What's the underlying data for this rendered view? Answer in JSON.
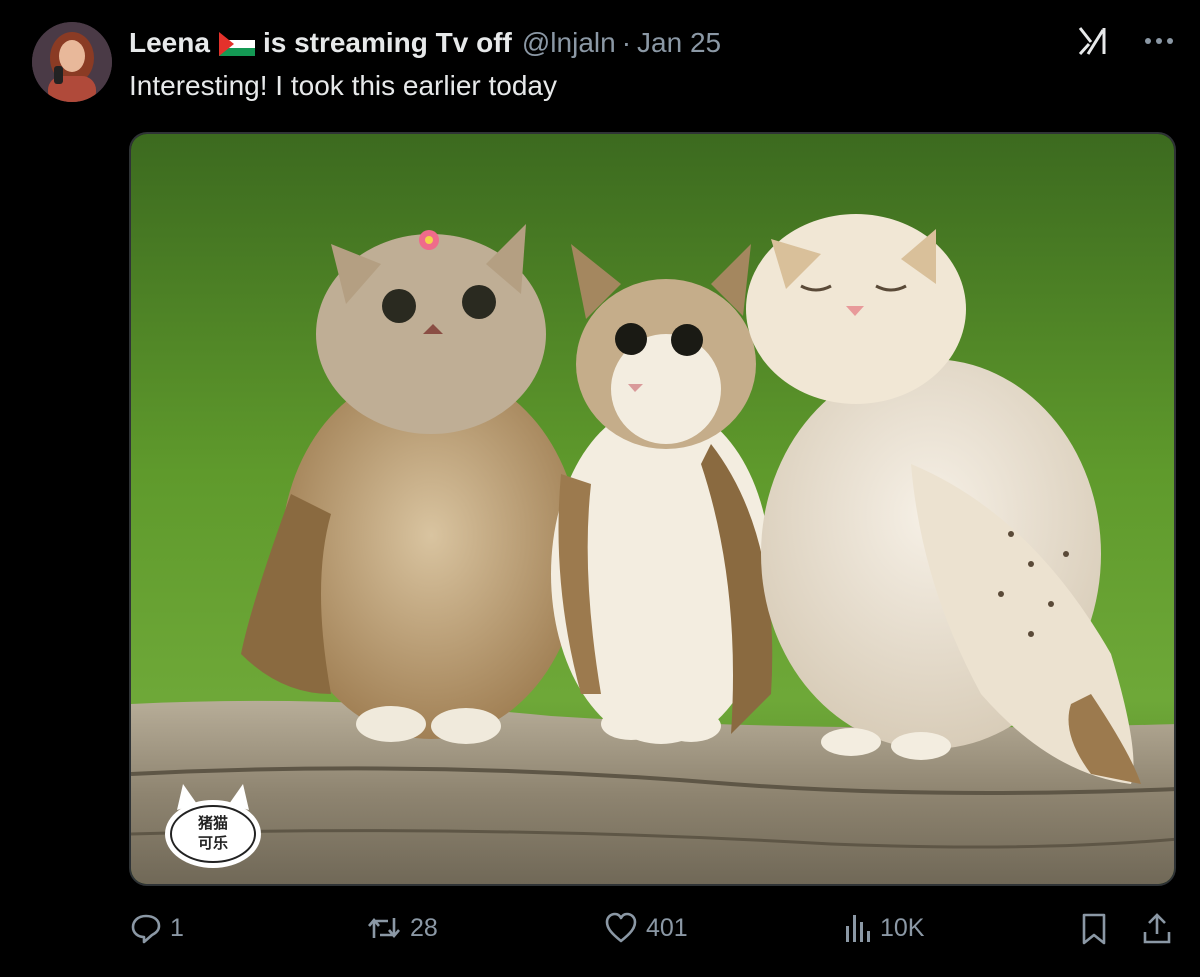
{
  "author": {
    "display_name": "Leena",
    "flag_icon": "palestine-flag-icon",
    "status_text": "is streaming Tv off",
    "handle": "@lnjaln",
    "separator": "·",
    "date": "Jan 25"
  },
  "tweet": {
    "text": "Interesting! I took this earlier today"
  },
  "media": {
    "description_icon": "cat-owl-hybrids-photo",
    "watermark_text": "猪猫可乐"
  },
  "actions": {
    "reply_count": "1",
    "retweet_count": "28",
    "like_count": "401",
    "view_count": "10K"
  },
  "icons": {
    "grok": "grok-icon",
    "more": "more-icon",
    "reply": "reply-icon",
    "retweet": "retweet-icon",
    "like": "heart-icon",
    "views": "views-icon",
    "bookmark": "bookmark-icon",
    "share": "share-icon"
  },
  "colors": {
    "background": "#000000",
    "text_primary": "#e7e9ea",
    "text_secondary": "#8b98a5"
  }
}
